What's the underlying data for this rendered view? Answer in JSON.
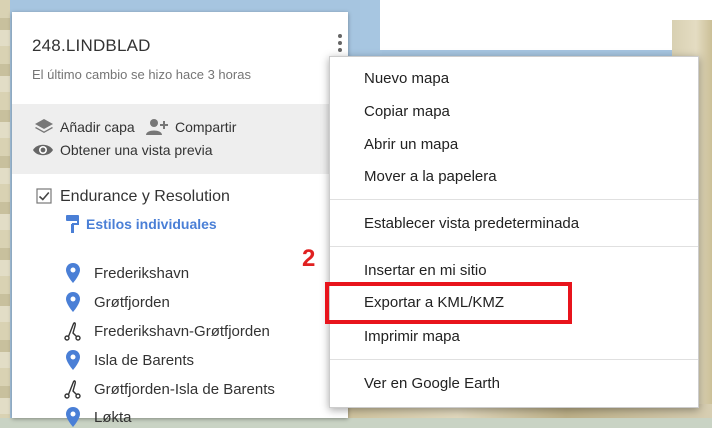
{
  "map_header": {
    "title": "248.LINDBLAD",
    "subtitle": "El último cambio se hizo hace 3 horas"
  },
  "toolbar": {
    "add_layer": "Añadir capa",
    "share": "Compartir",
    "preview": "Obtener una vista previa"
  },
  "layer": {
    "title": "Endurance y Resolution",
    "styles_label": "Estilos individuales",
    "features": [
      {
        "label": "Frederikshavn",
        "icon": "marker-icon"
      },
      {
        "label": "Grøtfjorden",
        "icon": "marker-icon"
      },
      {
        "label": "Frederikshavn-Grøtfjorden",
        "icon": "route-icon"
      },
      {
        "label": "Isla de Barents",
        "icon": "marker-icon"
      },
      {
        "label": "Grøtfjorden-Isla de Barents",
        "icon": "route-icon"
      },
      {
        "label": "Løkta",
        "icon": "marker-icon"
      }
    ]
  },
  "menu": {
    "items": [
      "Nuevo mapa",
      "Copiar mapa",
      "Abrir un mapa",
      "Mover a la papelera",
      "Establecer vista predeterminada",
      "Insertar en mi sitio",
      "Exportar a KML/KMZ",
      "Imprimir mapa",
      "Ver en Google Earth"
    ]
  },
  "annotation": {
    "step_number": "2",
    "color": "#e8141c"
  },
  "colors": {
    "accent": "#4a7fd6",
    "marker": "#4a7fd6",
    "toolbar_bg": "#eeeeee"
  }
}
